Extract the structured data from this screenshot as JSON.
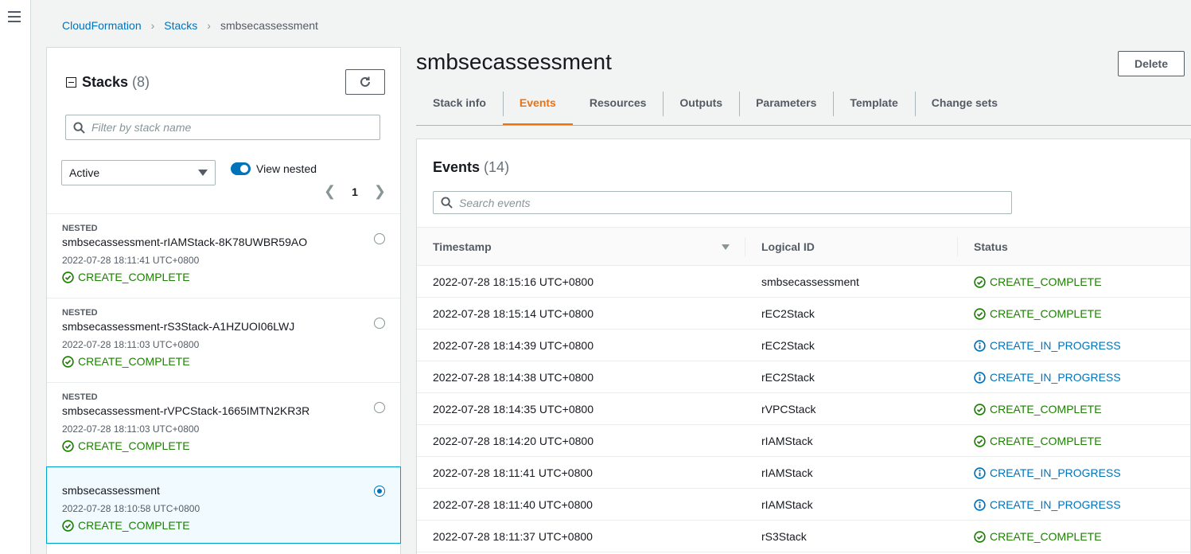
{
  "breadcrumb": [
    "CloudFormation",
    "Stacks",
    "smbsecassessment"
  ],
  "stacks_panel": {
    "title": "Stacks",
    "count": "(8)",
    "filter_placeholder": "Filter by stack name",
    "status_filter": "Active",
    "view_nested_label": "View nested",
    "page": "1",
    "items": [
      {
        "tag": "NESTED",
        "name": "smbsecassessment-rIAMStack-8K78UWBR59AO",
        "time": "2022-07-28 18:11:41 UTC+0800",
        "status": "CREATE_COMPLETE"
      },
      {
        "tag": "NESTED",
        "name": "smbsecassessment-rS3Stack-A1HZUOI06LWJ",
        "time": "2022-07-28 18:11:03 UTC+0800",
        "status": "CREATE_COMPLETE"
      },
      {
        "tag": "NESTED",
        "name": "smbsecassessment-rVPCStack-1665IMTN2KR3R",
        "time": "2022-07-28 18:11:03 UTC+0800",
        "status": "CREATE_COMPLETE"
      },
      {
        "tag": "",
        "name": "smbsecassessment",
        "time": "2022-07-28 18:10:58 UTC+0800",
        "status": "CREATE_COMPLETE"
      }
    ]
  },
  "stack": {
    "title": "smbsecassessment",
    "delete_label": "Delete",
    "tabs": [
      "Stack info",
      "Events",
      "Resources",
      "Outputs",
      "Parameters",
      "Template",
      "Change sets"
    ],
    "active_tab": "Events"
  },
  "events": {
    "title": "Events",
    "count": "(14)",
    "search_placeholder": "Search events",
    "columns": [
      "Timestamp",
      "Logical ID",
      "Status"
    ],
    "rows": [
      {
        "timestamp": "2022-07-28 18:15:16 UTC+0800",
        "logical_id": "smbsecassessment",
        "status": "CREATE_COMPLETE"
      },
      {
        "timestamp": "2022-07-28 18:15:14 UTC+0800",
        "logical_id": "rEC2Stack",
        "status": "CREATE_COMPLETE"
      },
      {
        "timestamp": "2022-07-28 18:14:39 UTC+0800",
        "logical_id": "rEC2Stack",
        "status": "CREATE_IN_PROGRESS"
      },
      {
        "timestamp": "2022-07-28 18:14:38 UTC+0800",
        "logical_id": "rEC2Stack",
        "status": "CREATE_IN_PROGRESS"
      },
      {
        "timestamp": "2022-07-28 18:14:35 UTC+0800",
        "logical_id": "rVPCStack",
        "status": "CREATE_COMPLETE"
      },
      {
        "timestamp": "2022-07-28 18:14:20 UTC+0800",
        "logical_id": "rIAMStack",
        "status": "CREATE_COMPLETE"
      },
      {
        "timestamp": "2022-07-28 18:11:41 UTC+0800",
        "logical_id": "rIAMStack",
        "status": "CREATE_IN_PROGRESS"
      },
      {
        "timestamp": "2022-07-28 18:11:40 UTC+0800",
        "logical_id": "rIAMStack",
        "status": "CREATE_IN_PROGRESS"
      },
      {
        "timestamp": "2022-07-28 18:11:37 UTC+0800",
        "logical_id": "rS3Stack",
        "status": "CREATE_COMPLETE"
      }
    ]
  },
  "colors": {
    "link": "#0073bb",
    "success": "#1d8102",
    "in_progress": "#0073bb",
    "active_tab": "#ec7211"
  },
  "icons": [
    "menu-icon",
    "refresh-icon",
    "search-icon",
    "chevron-left-icon",
    "chevron-right-icon",
    "success-icon",
    "info-icon",
    "sort-desc-icon"
  ]
}
